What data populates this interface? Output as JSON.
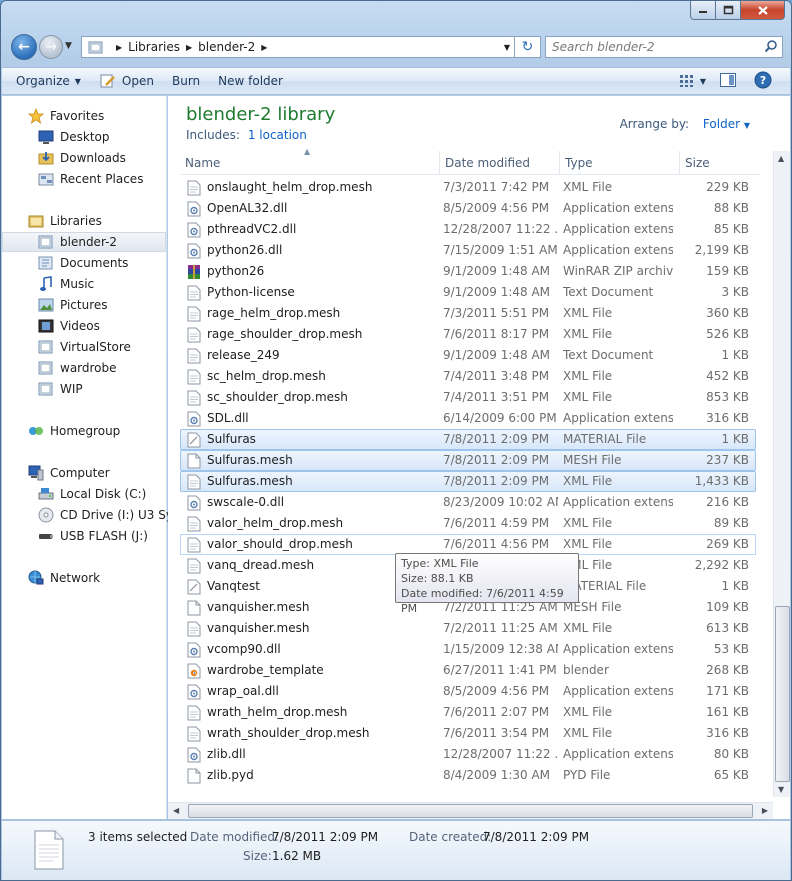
{
  "address": {
    "crumbs": [
      "Libraries",
      "blender-2"
    ]
  },
  "search": {
    "placeholder": "Search blender-2"
  },
  "toolbar": {
    "organize": "Organize",
    "open": "Open",
    "burn": "Burn",
    "new_folder": "New folder"
  },
  "nav": {
    "favorites": "Favorites",
    "favorite_items": [
      "Desktop",
      "Downloads",
      "Recent Places"
    ],
    "libraries": "Libraries",
    "library_items": [
      "blender-2",
      "Documents",
      "Music",
      "Pictures",
      "Videos",
      "VirtualStore",
      "wardrobe",
      "WIP"
    ],
    "homegroup": "Homegroup",
    "computer": "Computer",
    "computer_items": [
      "Local Disk (C:)",
      "CD Drive (I:) U3 System",
      "USB FLASH (J:)"
    ],
    "network": "Network"
  },
  "library": {
    "title": "blender-2 library",
    "includes_label": "Includes:",
    "includes_link": "1 location",
    "arrange_label": "Arrange by:",
    "arrange_value": "Folder"
  },
  "columns": {
    "name": "Name",
    "date": "Date modified",
    "type": "Type",
    "size": "Size"
  },
  "files": [
    {
      "name": "onslaught_helm_drop.mesh",
      "date": "7/3/2011 7:42 PM",
      "type": "XML File",
      "size": "229 KB",
      "icon": "xml-file-icon"
    },
    {
      "name": "OpenAL32.dll",
      "date": "8/5/2009 4:56 PM",
      "type": "Application extens...",
      "size": "88 KB",
      "icon": "dll-file-icon"
    },
    {
      "name": "pthreadVC2.dll",
      "date": "12/28/2007 11:22 ...",
      "type": "Application extens...",
      "size": "85 KB",
      "icon": "dll-file-icon"
    },
    {
      "name": "python26.dll",
      "date": "7/15/2009 1:51 AM",
      "type": "Application extens...",
      "size": "2,199 KB",
      "icon": "dll-file-icon"
    },
    {
      "name": "python26",
      "date": "9/1/2009 1:48 AM",
      "type": "WinRAR ZIP archive",
      "size": "159 KB",
      "icon": "winrar-icon"
    },
    {
      "name": "Python-license",
      "date": "9/1/2009 1:48 AM",
      "type": "Text Document",
      "size": "3 KB",
      "icon": "text-file-icon"
    },
    {
      "name": "rage_helm_drop.mesh",
      "date": "7/3/2011 5:51 PM",
      "type": "XML File",
      "size": "360 KB",
      "icon": "xml-file-icon"
    },
    {
      "name": "rage_shoulder_drop.mesh",
      "date": "7/6/2011 8:17 PM",
      "type": "XML File",
      "size": "526 KB",
      "icon": "xml-file-icon"
    },
    {
      "name": "release_249",
      "date": "9/1/2009 1:48 AM",
      "type": "Text Document",
      "size": "1 KB",
      "icon": "text-file-icon"
    },
    {
      "name": "sc_helm_drop.mesh",
      "date": "7/4/2011 3:48 PM",
      "type": "XML File",
      "size": "452 KB",
      "icon": "xml-file-icon"
    },
    {
      "name": "sc_shoulder_drop.mesh",
      "date": "7/4/2011 3:51 PM",
      "type": "XML File",
      "size": "853 KB",
      "icon": "xml-file-icon"
    },
    {
      "name": "SDL.dll",
      "date": "6/14/2009 6:00 PM",
      "type": "Application extens...",
      "size": "316 KB",
      "icon": "dll-file-icon"
    },
    {
      "name": "Sulfuras",
      "date": "7/8/2011 2:09 PM",
      "type": "MATERIAL File",
      "size": "1 KB",
      "icon": "material-file-icon",
      "selected": true
    },
    {
      "name": "Sulfuras.mesh",
      "date": "7/8/2011 2:09 PM",
      "type": "MESH File",
      "size": "237 KB",
      "icon": "mesh-file-icon",
      "selected": true
    },
    {
      "name": "Sulfuras.mesh",
      "date": "7/8/2011 2:09 PM",
      "type": "XML File",
      "size": "1,433 KB",
      "icon": "xml-file-icon",
      "selected": true
    },
    {
      "name": "swscale-0.dll",
      "date": "8/23/2009 10:02 AM",
      "type": "Application extens...",
      "size": "216 KB",
      "icon": "dll-file-icon"
    },
    {
      "name": "valor_helm_drop.mesh",
      "date": "7/6/2011 4:59 PM",
      "type": "XML File",
      "size": "89 KB",
      "icon": "xml-file-icon"
    },
    {
      "name": "valor_should_drop.mesh",
      "date": "7/6/2011 4:56 PM",
      "type": "XML File",
      "size": "269 KB",
      "icon": "xml-file-icon",
      "hover": true
    },
    {
      "name": "vanq_dread.mesh",
      "date": "7/2/2011 11:25 AM",
      "type": "XML File",
      "size": "2,292 KB",
      "icon": "xml-file-icon"
    },
    {
      "name": "Vanqtest",
      "date": "7/8/2011 2:09 PM",
      "type": "MATERIAL File",
      "size": "1 KB",
      "icon": "material-file-icon"
    },
    {
      "name": "vanquisher.mesh",
      "date": "7/2/2011 11:25 AM",
      "type": "MESH File",
      "size": "109 KB",
      "icon": "mesh-file-icon"
    },
    {
      "name": "vanquisher.mesh",
      "date": "7/2/2011 11:25 AM",
      "type": "XML File",
      "size": "613 KB",
      "icon": "xml-file-icon"
    },
    {
      "name": "vcomp90.dll",
      "date": "1/15/2009 12:38 AM",
      "type": "Application extens...",
      "size": "53 KB",
      "icon": "dll-file-icon"
    },
    {
      "name": "wardrobe_template",
      "date": "6/27/2011 1:41 PM",
      "type": "blender",
      "size": "268 KB",
      "icon": "blender-file-icon"
    },
    {
      "name": "wrap_oal.dll",
      "date": "8/5/2009 4:56 PM",
      "type": "Application extens...",
      "size": "171 KB",
      "icon": "dll-file-icon"
    },
    {
      "name": "wrath_helm_drop.mesh",
      "date": "7/6/2011 2:07 PM",
      "type": "XML File",
      "size": "161 KB",
      "icon": "xml-file-icon"
    },
    {
      "name": "wrath_shoulder_drop.mesh",
      "date": "7/6/2011 3:54 PM",
      "type": "XML File",
      "size": "316 KB",
      "icon": "xml-file-icon"
    },
    {
      "name": "zlib.dll",
      "date": "12/28/2007 11:22 ...",
      "type": "Application extens...",
      "size": "80 KB",
      "icon": "dll-file-icon"
    },
    {
      "name": "zlib.pyd",
      "date": "8/4/2009 1:30 AM",
      "type": "PYD File",
      "size": "65 KB",
      "icon": "generic-file-icon"
    }
  ],
  "tooltip": {
    "type": "Type: XML File",
    "size": "Size: 88.1 KB",
    "date": "Date modified: 7/6/2011 4:59 PM"
  },
  "details": {
    "summary": "3 items selected",
    "date_modified_label": "Date modified:",
    "date_modified": "7/8/2011 2:09 PM",
    "date_created_label": "Date created:",
    "date_created": "7/8/2011 2:09 PM",
    "size_label": "Size:",
    "size": "1.62 MB"
  },
  "colors": {
    "title_green": "#1e7b2f",
    "link_blue": "#0f63c8",
    "selection": "#d7e7fa"
  }
}
